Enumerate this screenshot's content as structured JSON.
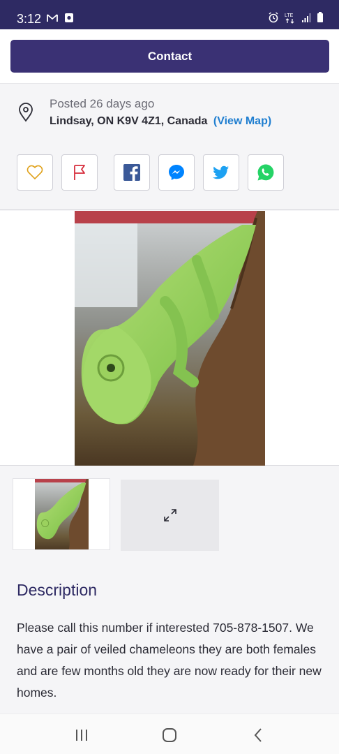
{
  "status_bar": {
    "time": "3:12",
    "left_icons": [
      "gmail-icon",
      "notification-icon"
    ],
    "right_icons": [
      "alarm-icon",
      "lte-icon",
      "signal-icon",
      "battery-icon"
    ],
    "network_label": "LTE"
  },
  "contact": {
    "label": "Contact"
  },
  "listing": {
    "posted": "Posted 26 days ago",
    "location": "Lindsay, ON K9V 4Z1, Canada",
    "view_map": "(View Map)"
  },
  "actions": [
    {
      "icon": "heart-icon",
      "color": "#e0a21c"
    },
    {
      "icon": "flag-icon",
      "color": "#d62c3b"
    },
    {
      "icon": "facebook-icon",
      "color": "#3b5998"
    },
    {
      "icon": "messenger-icon",
      "color": "#0084ff"
    },
    {
      "icon": "twitter-icon",
      "color": "#1da1f2"
    },
    {
      "icon": "whatsapp-icon",
      "color": "#25d366"
    }
  ],
  "gallery": {
    "expand_icon": "expand-icon"
  },
  "description": {
    "title": "Description",
    "body": "Please call this number if interested 705-878-1507. We have a pair of veiled chameleons they are both females and are few months old they are now ready for their new homes."
  },
  "nav_bar": {
    "icons": [
      "recent-apps-icon",
      "home-icon",
      "back-icon"
    ]
  }
}
